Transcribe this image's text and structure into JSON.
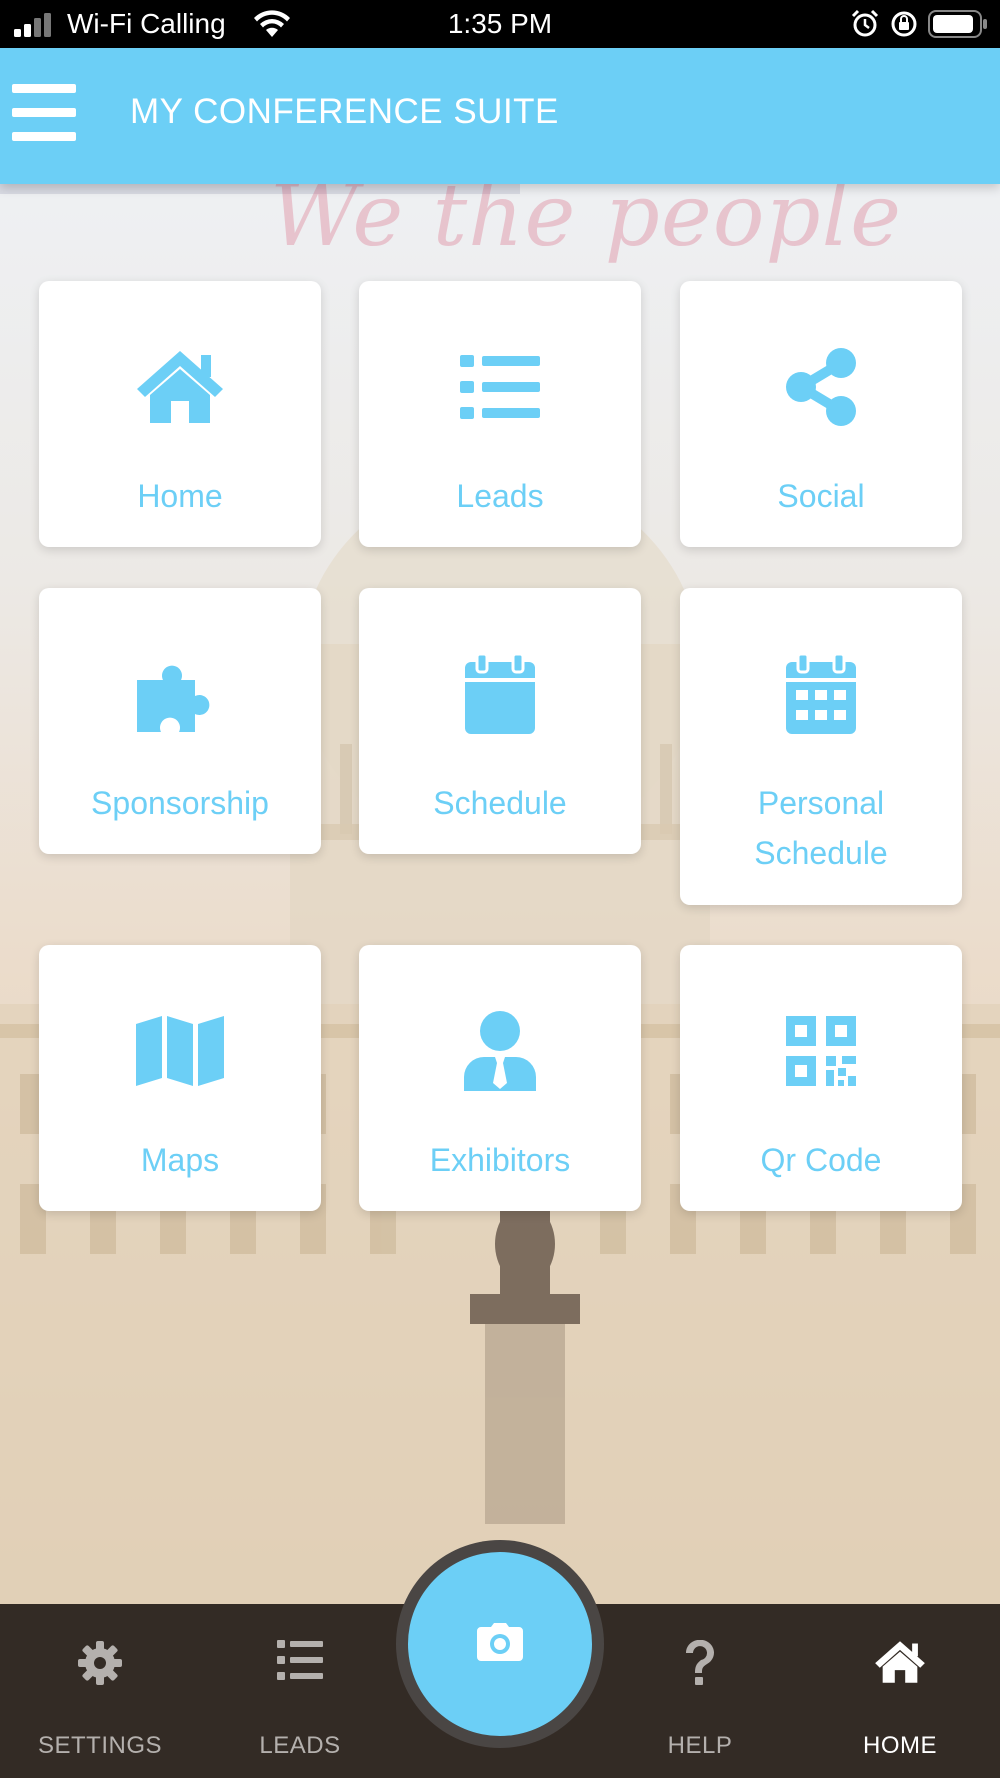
{
  "status_bar": {
    "carrier": "Wi-Fi Calling",
    "time": "1:35 PM"
  },
  "header": {
    "title": "MY CONFERENCE SUITE"
  },
  "background": {
    "watermark_text": "We the people"
  },
  "tiles": [
    {
      "label": "Home",
      "icon": "home-icon"
    },
    {
      "label": "Leads",
      "icon": "list-icon"
    },
    {
      "label": "Social",
      "icon": "share-icon"
    },
    {
      "label": "Sponsorship",
      "icon": "puzzle-icon"
    },
    {
      "label": "Schedule",
      "icon": "calendar-icon"
    },
    {
      "label": "Personal Schedule",
      "icon": "calendar-grid-icon"
    },
    {
      "label": "Maps",
      "icon": "map-icon"
    },
    {
      "label": "Exhibitors",
      "icon": "person-tie-icon"
    },
    {
      "label": "Qr Code",
      "icon": "qr-code-icon"
    }
  ],
  "tabbar": {
    "items": [
      {
        "label": "SETTINGS",
        "icon": "gear-icon"
      },
      {
        "label": "LEADS",
        "icon": "list-icon"
      },
      {
        "label": "HELP",
        "icon": "question-icon"
      },
      {
        "label": "HOME",
        "icon": "home-icon",
        "active": true
      }
    ],
    "center_action": {
      "icon": "camera-icon"
    }
  },
  "colors": {
    "accent": "#6ccff6",
    "tabbar_bg": "#332b25",
    "status_bar_bg": "#000000"
  }
}
